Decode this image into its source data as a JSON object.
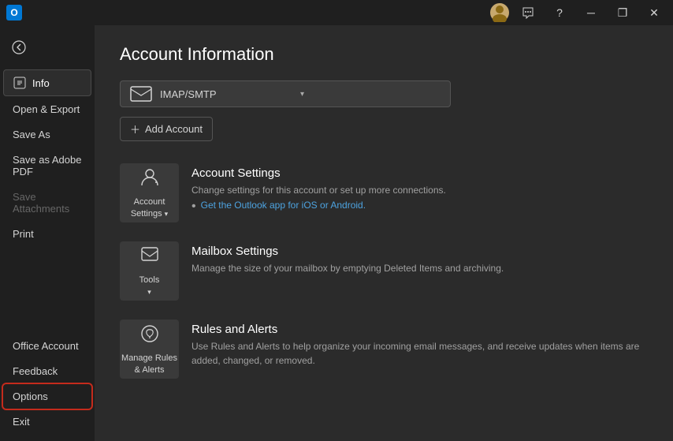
{
  "titleBar": {
    "appName": "Outlook",
    "logoText": "O",
    "icons": {
      "help": "?",
      "minimize": "─",
      "restore": "❐",
      "close": "✕"
    }
  },
  "sidebar": {
    "backIcon": "←",
    "items": [
      {
        "id": "info",
        "label": "Info",
        "active": true
      },
      {
        "id": "open-export",
        "label": "Open & Export",
        "active": false
      },
      {
        "id": "save-as",
        "label": "Save As",
        "active": false
      },
      {
        "id": "save-adobe",
        "label": "Save as Adobe PDF",
        "active": false
      },
      {
        "id": "save-attachments",
        "label": "Save Attachments",
        "active": false,
        "disabled": true
      },
      {
        "id": "print",
        "label": "Print",
        "active": false
      }
    ],
    "bottomItems": [
      {
        "id": "office-account",
        "label": "Office Account",
        "active": false
      },
      {
        "id": "feedback",
        "label": "Feedback",
        "active": false
      },
      {
        "id": "options",
        "label": "Options",
        "active": false,
        "highlighted": true
      },
      {
        "id": "exit",
        "label": "Exit",
        "active": false
      }
    ]
  },
  "content": {
    "title": "Account Information",
    "accountDropdown": {
      "value": "IMAP/SMTP",
      "placeholder": "IMAP/SMTP"
    },
    "addAccountButton": "+ Add Account",
    "cards": [
      {
        "id": "account-settings",
        "iconLabel": "Account\nSettings",
        "title": "Account Settings",
        "description": "Change settings for this account or set up more connections.",
        "link": "Get the Outlook app for iOS or Android.",
        "linkHref": "#"
      },
      {
        "id": "mailbox-settings",
        "iconLabel": "Tools",
        "title": "Mailbox Settings",
        "description": "Manage the size of your mailbox by emptying Deleted Items and archiving.",
        "link": null
      },
      {
        "id": "rules-alerts",
        "iconLabel": "Manage Rules\n& Alerts",
        "title": "Rules and Alerts",
        "description": "Use Rules and Alerts to help organize your incoming email messages, and receive updates when items are added, changed, or removed.",
        "link": null
      }
    ]
  }
}
